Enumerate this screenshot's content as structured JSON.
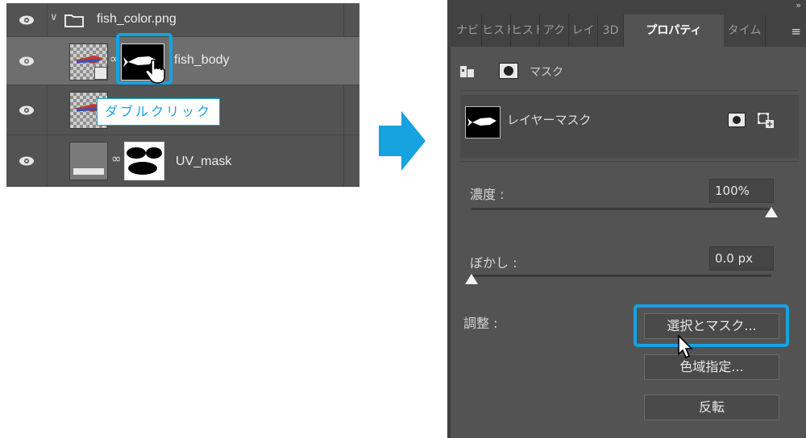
{
  "layers_panel": {
    "group": {
      "name": "fish_color.png"
    },
    "layers": [
      {
        "name": "fish_body",
        "selected": true
      },
      {
        "name": ""
      },
      {
        "name": "UV_mask"
      }
    ],
    "callout": "ダブルクリック"
  },
  "properties_panel": {
    "tabs": [
      {
        "label": "ナビ"
      },
      {
        "label": "ヒスト"
      },
      {
        "label": "ヒスト"
      },
      {
        "label": "アク"
      },
      {
        "label": "レイ"
      },
      {
        "label": "3D"
      },
      {
        "label": "プロパティ",
        "active": true
      },
      {
        "label": "タイム"
      }
    ],
    "collapse_icon": "»",
    "menu_icon": "≡",
    "section_label": "マスク",
    "mask_name": "レイヤーマスク",
    "density": {
      "label": "濃度 :",
      "value": "100%",
      "level": 1.0
    },
    "feather": {
      "label": "ぼかし :",
      "value": "0.0 px",
      "level": 0.0
    },
    "adjust_label": "調整 :",
    "buttons": {
      "select_and_mask": "選択とマスク...",
      "color_range": "色域指定...",
      "invert": "反転"
    }
  },
  "colors": {
    "highlight": "#17a2e0",
    "panel_bg": "#535353",
    "selected_row": "#6e6e6e"
  }
}
